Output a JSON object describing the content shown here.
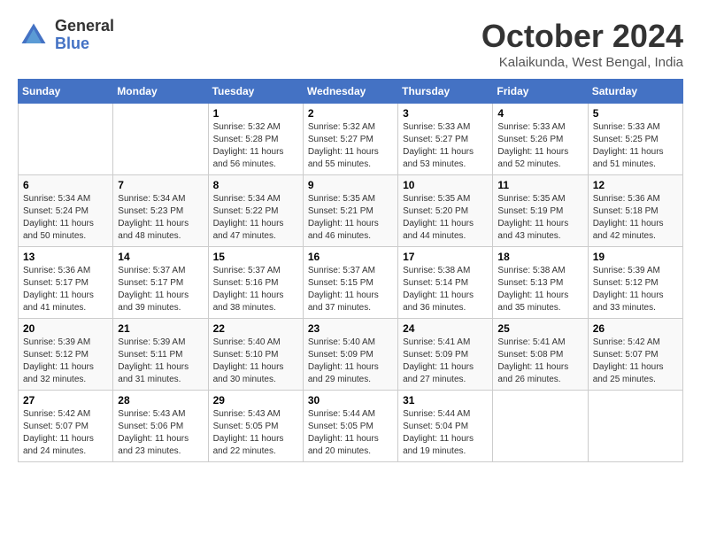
{
  "header": {
    "logo_general": "General",
    "logo_blue": "Blue",
    "month_title": "October 2024",
    "location": "Kalaikunda, West Bengal, India"
  },
  "days_of_week": [
    "Sunday",
    "Monday",
    "Tuesday",
    "Wednesday",
    "Thursday",
    "Friday",
    "Saturday"
  ],
  "weeks": [
    [
      {
        "day": "",
        "sunrise": "",
        "sunset": "",
        "daylight": ""
      },
      {
        "day": "",
        "sunrise": "",
        "sunset": "",
        "daylight": ""
      },
      {
        "day": "1",
        "sunrise": "Sunrise: 5:32 AM",
        "sunset": "Sunset: 5:28 PM",
        "daylight": "Daylight: 11 hours and 56 minutes."
      },
      {
        "day": "2",
        "sunrise": "Sunrise: 5:32 AM",
        "sunset": "Sunset: 5:27 PM",
        "daylight": "Daylight: 11 hours and 55 minutes."
      },
      {
        "day": "3",
        "sunrise": "Sunrise: 5:33 AM",
        "sunset": "Sunset: 5:27 PM",
        "daylight": "Daylight: 11 hours and 53 minutes."
      },
      {
        "day": "4",
        "sunrise": "Sunrise: 5:33 AM",
        "sunset": "Sunset: 5:26 PM",
        "daylight": "Daylight: 11 hours and 52 minutes."
      },
      {
        "day": "5",
        "sunrise": "Sunrise: 5:33 AM",
        "sunset": "Sunset: 5:25 PM",
        "daylight": "Daylight: 11 hours and 51 minutes."
      }
    ],
    [
      {
        "day": "6",
        "sunrise": "Sunrise: 5:34 AM",
        "sunset": "Sunset: 5:24 PM",
        "daylight": "Daylight: 11 hours and 50 minutes."
      },
      {
        "day": "7",
        "sunrise": "Sunrise: 5:34 AM",
        "sunset": "Sunset: 5:23 PM",
        "daylight": "Daylight: 11 hours and 48 minutes."
      },
      {
        "day": "8",
        "sunrise": "Sunrise: 5:34 AM",
        "sunset": "Sunset: 5:22 PM",
        "daylight": "Daylight: 11 hours and 47 minutes."
      },
      {
        "day": "9",
        "sunrise": "Sunrise: 5:35 AM",
        "sunset": "Sunset: 5:21 PM",
        "daylight": "Daylight: 11 hours and 46 minutes."
      },
      {
        "day": "10",
        "sunrise": "Sunrise: 5:35 AM",
        "sunset": "Sunset: 5:20 PM",
        "daylight": "Daylight: 11 hours and 44 minutes."
      },
      {
        "day": "11",
        "sunrise": "Sunrise: 5:35 AM",
        "sunset": "Sunset: 5:19 PM",
        "daylight": "Daylight: 11 hours and 43 minutes."
      },
      {
        "day": "12",
        "sunrise": "Sunrise: 5:36 AM",
        "sunset": "Sunset: 5:18 PM",
        "daylight": "Daylight: 11 hours and 42 minutes."
      }
    ],
    [
      {
        "day": "13",
        "sunrise": "Sunrise: 5:36 AM",
        "sunset": "Sunset: 5:17 PM",
        "daylight": "Daylight: 11 hours and 41 minutes."
      },
      {
        "day": "14",
        "sunrise": "Sunrise: 5:37 AM",
        "sunset": "Sunset: 5:17 PM",
        "daylight": "Daylight: 11 hours and 39 minutes."
      },
      {
        "day": "15",
        "sunrise": "Sunrise: 5:37 AM",
        "sunset": "Sunset: 5:16 PM",
        "daylight": "Daylight: 11 hours and 38 minutes."
      },
      {
        "day": "16",
        "sunrise": "Sunrise: 5:37 AM",
        "sunset": "Sunset: 5:15 PM",
        "daylight": "Daylight: 11 hours and 37 minutes."
      },
      {
        "day": "17",
        "sunrise": "Sunrise: 5:38 AM",
        "sunset": "Sunset: 5:14 PM",
        "daylight": "Daylight: 11 hours and 36 minutes."
      },
      {
        "day": "18",
        "sunrise": "Sunrise: 5:38 AM",
        "sunset": "Sunset: 5:13 PM",
        "daylight": "Daylight: 11 hours and 35 minutes."
      },
      {
        "day": "19",
        "sunrise": "Sunrise: 5:39 AM",
        "sunset": "Sunset: 5:12 PM",
        "daylight": "Daylight: 11 hours and 33 minutes."
      }
    ],
    [
      {
        "day": "20",
        "sunrise": "Sunrise: 5:39 AM",
        "sunset": "Sunset: 5:12 PM",
        "daylight": "Daylight: 11 hours and 32 minutes."
      },
      {
        "day": "21",
        "sunrise": "Sunrise: 5:39 AM",
        "sunset": "Sunset: 5:11 PM",
        "daylight": "Daylight: 11 hours and 31 minutes."
      },
      {
        "day": "22",
        "sunrise": "Sunrise: 5:40 AM",
        "sunset": "Sunset: 5:10 PM",
        "daylight": "Daylight: 11 hours and 30 minutes."
      },
      {
        "day": "23",
        "sunrise": "Sunrise: 5:40 AM",
        "sunset": "Sunset: 5:09 PM",
        "daylight": "Daylight: 11 hours and 29 minutes."
      },
      {
        "day": "24",
        "sunrise": "Sunrise: 5:41 AM",
        "sunset": "Sunset: 5:09 PM",
        "daylight": "Daylight: 11 hours and 27 minutes."
      },
      {
        "day": "25",
        "sunrise": "Sunrise: 5:41 AM",
        "sunset": "Sunset: 5:08 PM",
        "daylight": "Daylight: 11 hours and 26 minutes."
      },
      {
        "day": "26",
        "sunrise": "Sunrise: 5:42 AM",
        "sunset": "Sunset: 5:07 PM",
        "daylight": "Daylight: 11 hours and 25 minutes."
      }
    ],
    [
      {
        "day": "27",
        "sunrise": "Sunrise: 5:42 AM",
        "sunset": "Sunset: 5:07 PM",
        "daylight": "Daylight: 11 hours and 24 minutes."
      },
      {
        "day": "28",
        "sunrise": "Sunrise: 5:43 AM",
        "sunset": "Sunset: 5:06 PM",
        "daylight": "Daylight: 11 hours and 23 minutes."
      },
      {
        "day": "29",
        "sunrise": "Sunrise: 5:43 AM",
        "sunset": "Sunset: 5:05 PM",
        "daylight": "Daylight: 11 hours and 22 minutes."
      },
      {
        "day": "30",
        "sunrise": "Sunrise: 5:44 AM",
        "sunset": "Sunset: 5:05 PM",
        "daylight": "Daylight: 11 hours and 20 minutes."
      },
      {
        "day": "31",
        "sunrise": "Sunrise: 5:44 AM",
        "sunset": "Sunset: 5:04 PM",
        "daylight": "Daylight: 11 hours and 19 minutes."
      },
      {
        "day": "",
        "sunrise": "",
        "sunset": "",
        "daylight": ""
      },
      {
        "day": "",
        "sunrise": "",
        "sunset": "",
        "daylight": ""
      }
    ]
  ]
}
